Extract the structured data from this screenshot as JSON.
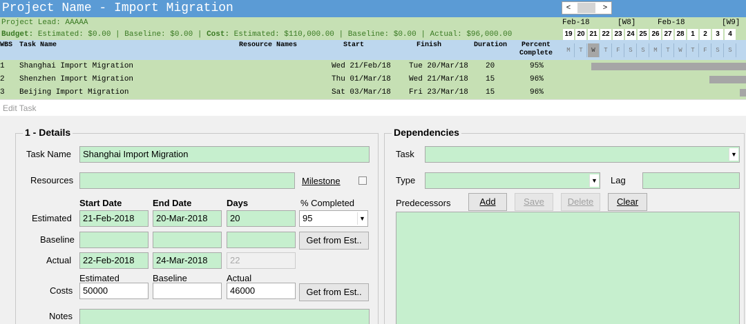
{
  "project": {
    "title": "Project Name - Import Migration",
    "lead": "Project Lead: AAAAA",
    "budget_label": "Budget:",
    "budget_estimated": " Estimated: $0.00 | Baseline: $0.00 | ",
    "cost_label": "Cost:",
    "cost_values": " Estimated: $110,000.00 | Baseline: $0.00 | Actual: $96,000.00"
  },
  "columns": {
    "wbs": "WBS",
    "task_name": "Task Name",
    "resource_names": "Resource Names",
    "start": "Start",
    "finish": "Finish",
    "duration": "Duration",
    "percent_line1": "Percent",
    "percent_line2": "Complete"
  },
  "tasks": [
    {
      "wbs": "1",
      "name": "Shanghai Import Migration",
      "start": "Wed 21/Feb/18",
      "finish": "Tue 20/Mar/18",
      "duration": "20",
      "percent": "95%"
    },
    {
      "wbs": "2",
      "name": "Shenzhen Import Migration",
      "start": "Thu 01/Mar/18",
      "finish": "Wed 21/Mar/18",
      "duration": "15",
      "percent": "96%"
    },
    {
      "wbs": "3",
      "name": "Beijing Import Migration",
      "start": "Sat 03/Mar/18",
      "finish": "Fri 23/Mar/18",
      "duration": "15",
      "percent": "96%"
    }
  ],
  "gantt": {
    "nav_left": "<",
    "nav_right": ">",
    "months": [
      {
        "label": "Feb-18"
      },
      {
        "label": "[W8]"
      },
      {
        "label": "Feb-18"
      },
      {
        "label": "[W9]"
      }
    ],
    "days": [
      "19",
      "20",
      "21",
      "22",
      "23",
      "24",
      "25",
      "26",
      "27",
      "28",
      "1",
      "2",
      "3",
      "4"
    ],
    "weekdays": [
      "M",
      "T",
      "W",
      "T",
      "F",
      "S",
      "S",
      "M",
      "T",
      "W",
      "T",
      "F",
      "S",
      "S"
    ],
    "today_index": 2,
    "bars": [
      {
        "start_index": 2.3
      },
      {
        "start_index": 11.8
      },
      {
        "start_index": 14.2
      }
    ],
    "bar_color": "#a6a6a6"
  },
  "dialog": {
    "title": "Edit Task",
    "details_title": "1 - Details",
    "task_name_label": "Task Name",
    "task_name_value": "Shanghai Import Migration",
    "resources_label": "Resources",
    "resources_value": "",
    "milestone_label": "Milestone",
    "start_date_hdr": "Start Date",
    "end_date_hdr": "End Date",
    "days_hdr": "Days",
    "pct_completed_hdr": "% Completed",
    "estimated_label": "Estimated",
    "est_start": "21-Feb-2018",
    "est_end": "20-Mar-2018",
    "est_days": "20",
    "pct_value": "95",
    "baseline_label": "Baseline",
    "base_start": "",
    "base_end": "",
    "base_days": "",
    "get_from_est": "Get from Est..",
    "actual_label": "Actual",
    "act_start": "22-Feb-2018",
    "act_end": "24-Mar-2018",
    "act_days": "22",
    "costs_label": "Costs",
    "cost_est_hdr": "Estimated",
    "cost_base_hdr": "Baseline",
    "cost_act_hdr": "Actual",
    "cost_est": "50000",
    "cost_base": "",
    "cost_act": "46000",
    "get_from_est_costs": "Get from Est..",
    "notes_label": "Notes",
    "dependencies_title": "Dependencies",
    "dep_task_label": "Task",
    "dep_type_label": "Type",
    "dep_lag_label": "Lag",
    "predecessors_label": "Predecessors",
    "add_btn": "Add",
    "save_btn": "Save",
    "delete_btn": "Delete",
    "clear_btn": "Clear"
  },
  "colors": {
    "title_blue": "#5b9bd5",
    "header_blue": "#bdd7ee",
    "row_green": "#c6e0b4",
    "field_green": "#c6efce",
    "dialog_bg": "#f0f0f0"
  }
}
